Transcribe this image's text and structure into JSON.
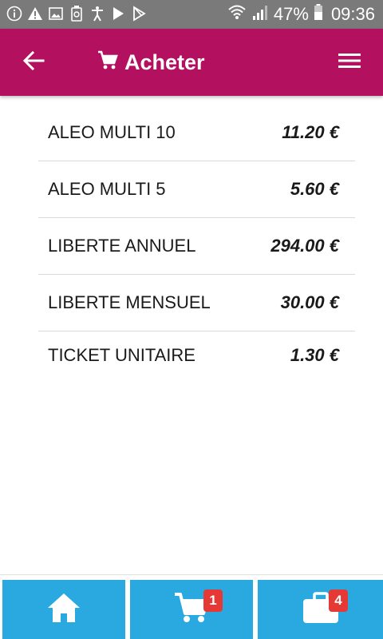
{
  "status_bar": {
    "battery": "47%",
    "time": "09:36"
  },
  "header": {
    "title": "Acheter",
    "background": "#b3115f"
  },
  "products": [
    {
      "name": "ALEO MULTI 10",
      "price": "11.20 €"
    },
    {
      "name": "ALEO MULTI 5",
      "price": "5.60 €"
    },
    {
      "name": "LIBERTE ANNUEL",
      "price": "294.00 €"
    },
    {
      "name": "LIBERTE MENSUEL",
      "price": "30.00 €"
    },
    {
      "name": "TICKET UNITAIRE",
      "price": "1.30 €"
    }
  ],
  "bottom_nav": {
    "accent": "#2aa9e0",
    "cart_badge": "1",
    "bag_badge": "4"
  },
  "icons": {
    "status_left": [
      "info-icon",
      "warning-icon",
      "image-icon",
      "recycle-icon",
      "accessibility-icon",
      "play-store-icon",
      "play-outline-icon"
    ],
    "status_right": [
      "wifi-icon",
      "signal-icon",
      "battery-icon"
    ],
    "header": [
      "back-arrow-icon",
      "cart-icon",
      "menu-icon"
    ],
    "nav": [
      "home-icon",
      "cart-icon",
      "briefcase-icon"
    ]
  }
}
